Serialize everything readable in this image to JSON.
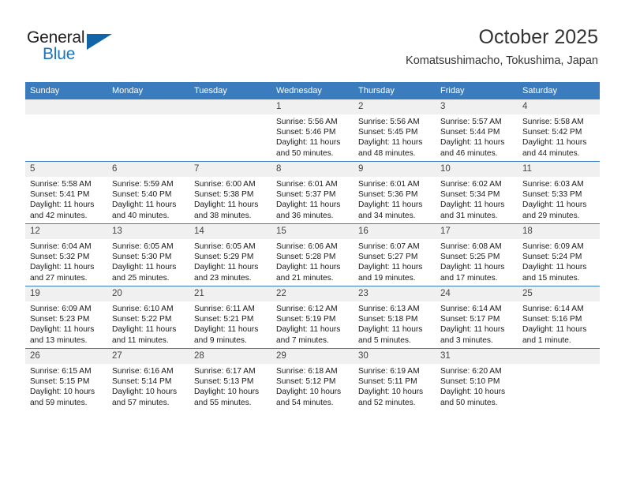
{
  "brand": {
    "name_part1": "General",
    "name_part2": "Blue"
  },
  "header": {
    "title": "October 2025",
    "subtitle": "Komatsushimacho, Tokushima, Japan"
  },
  "weekday_headers": [
    "Sunday",
    "Monday",
    "Tuesday",
    "Wednesday",
    "Thursday",
    "Friday",
    "Saturday"
  ],
  "colors": {
    "header_blue": "#3a7cbe",
    "brand_blue": "#1a74bb",
    "daynum_bg": "#f0f0f0",
    "text": "#1a1a1a"
  },
  "weeks": [
    [
      {
        "day": "",
        "empty": true,
        "sunrise": "",
        "sunset": "",
        "daylight1": "",
        "daylight2": ""
      },
      {
        "day": "",
        "empty": true,
        "sunrise": "",
        "sunset": "",
        "daylight1": "",
        "daylight2": ""
      },
      {
        "day": "",
        "empty": true,
        "sunrise": "",
        "sunset": "",
        "daylight1": "",
        "daylight2": ""
      },
      {
        "day": "1",
        "sunrise": "Sunrise: 5:56 AM",
        "sunset": "Sunset: 5:46 PM",
        "daylight1": "Daylight: 11 hours",
        "daylight2": "and 50 minutes."
      },
      {
        "day": "2",
        "sunrise": "Sunrise: 5:56 AM",
        "sunset": "Sunset: 5:45 PM",
        "daylight1": "Daylight: 11 hours",
        "daylight2": "and 48 minutes."
      },
      {
        "day": "3",
        "sunrise": "Sunrise: 5:57 AM",
        "sunset": "Sunset: 5:44 PM",
        "daylight1": "Daylight: 11 hours",
        "daylight2": "and 46 minutes."
      },
      {
        "day": "4",
        "sunrise": "Sunrise: 5:58 AM",
        "sunset": "Sunset: 5:42 PM",
        "daylight1": "Daylight: 11 hours",
        "daylight2": "and 44 minutes."
      }
    ],
    [
      {
        "day": "5",
        "sunrise": "Sunrise: 5:58 AM",
        "sunset": "Sunset: 5:41 PM",
        "daylight1": "Daylight: 11 hours",
        "daylight2": "and 42 minutes."
      },
      {
        "day": "6",
        "sunrise": "Sunrise: 5:59 AM",
        "sunset": "Sunset: 5:40 PM",
        "daylight1": "Daylight: 11 hours",
        "daylight2": "and 40 minutes."
      },
      {
        "day": "7",
        "sunrise": "Sunrise: 6:00 AM",
        "sunset": "Sunset: 5:38 PM",
        "daylight1": "Daylight: 11 hours",
        "daylight2": "and 38 minutes."
      },
      {
        "day": "8",
        "sunrise": "Sunrise: 6:01 AM",
        "sunset": "Sunset: 5:37 PM",
        "daylight1": "Daylight: 11 hours",
        "daylight2": "and 36 minutes."
      },
      {
        "day": "9",
        "sunrise": "Sunrise: 6:01 AM",
        "sunset": "Sunset: 5:36 PM",
        "daylight1": "Daylight: 11 hours",
        "daylight2": "and 34 minutes."
      },
      {
        "day": "10",
        "sunrise": "Sunrise: 6:02 AM",
        "sunset": "Sunset: 5:34 PM",
        "daylight1": "Daylight: 11 hours",
        "daylight2": "and 31 minutes."
      },
      {
        "day": "11",
        "sunrise": "Sunrise: 6:03 AM",
        "sunset": "Sunset: 5:33 PM",
        "daylight1": "Daylight: 11 hours",
        "daylight2": "and 29 minutes."
      }
    ],
    [
      {
        "day": "12",
        "sunrise": "Sunrise: 6:04 AM",
        "sunset": "Sunset: 5:32 PM",
        "daylight1": "Daylight: 11 hours",
        "daylight2": "and 27 minutes."
      },
      {
        "day": "13",
        "sunrise": "Sunrise: 6:05 AM",
        "sunset": "Sunset: 5:30 PM",
        "daylight1": "Daylight: 11 hours",
        "daylight2": "and 25 minutes."
      },
      {
        "day": "14",
        "sunrise": "Sunrise: 6:05 AM",
        "sunset": "Sunset: 5:29 PM",
        "daylight1": "Daylight: 11 hours",
        "daylight2": "and 23 minutes."
      },
      {
        "day": "15",
        "sunrise": "Sunrise: 6:06 AM",
        "sunset": "Sunset: 5:28 PM",
        "daylight1": "Daylight: 11 hours",
        "daylight2": "and 21 minutes."
      },
      {
        "day": "16",
        "sunrise": "Sunrise: 6:07 AM",
        "sunset": "Sunset: 5:27 PM",
        "daylight1": "Daylight: 11 hours",
        "daylight2": "and 19 minutes."
      },
      {
        "day": "17",
        "sunrise": "Sunrise: 6:08 AM",
        "sunset": "Sunset: 5:25 PM",
        "daylight1": "Daylight: 11 hours",
        "daylight2": "and 17 minutes."
      },
      {
        "day": "18",
        "sunrise": "Sunrise: 6:09 AM",
        "sunset": "Sunset: 5:24 PM",
        "daylight1": "Daylight: 11 hours",
        "daylight2": "and 15 minutes."
      }
    ],
    [
      {
        "day": "19",
        "sunrise": "Sunrise: 6:09 AM",
        "sunset": "Sunset: 5:23 PM",
        "daylight1": "Daylight: 11 hours",
        "daylight2": "and 13 minutes."
      },
      {
        "day": "20",
        "sunrise": "Sunrise: 6:10 AM",
        "sunset": "Sunset: 5:22 PM",
        "daylight1": "Daylight: 11 hours",
        "daylight2": "and 11 minutes."
      },
      {
        "day": "21",
        "sunrise": "Sunrise: 6:11 AM",
        "sunset": "Sunset: 5:21 PM",
        "daylight1": "Daylight: 11 hours",
        "daylight2": "and 9 minutes."
      },
      {
        "day": "22",
        "sunrise": "Sunrise: 6:12 AM",
        "sunset": "Sunset: 5:19 PM",
        "daylight1": "Daylight: 11 hours",
        "daylight2": "and 7 minutes."
      },
      {
        "day": "23",
        "sunrise": "Sunrise: 6:13 AM",
        "sunset": "Sunset: 5:18 PM",
        "daylight1": "Daylight: 11 hours",
        "daylight2": "and 5 minutes."
      },
      {
        "day": "24",
        "sunrise": "Sunrise: 6:14 AM",
        "sunset": "Sunset: 5:17 PM",
        "daylight1": "Daylight: 11 hours",
        "daylight2": "and 3 minutes."
      },
      {
        "day": "25",
        "sunrise": "Sunrise: 6:14 AM",
        "sunset": "Sunset: 5:16 PM",
        "daylight1": "Daylight: 11 hours",
        "daylight2": "and 1 minute."
      }
    ],
    [
      {
        "day": "26",
        "sunrise": "Sunrise: 6:15 AM",
        "sunset": "Sunset: 5:15 PM",
        "daylight1": "Daylight: 10 hours",
        "daylight2": "and 59 minutes."
      },
      {
        "day": "27",
        "sunrise": "Sunrise: 6:16 AM",
        "sunset": "Sunset: 5:14 PM",
        "daylight1": "Daylight: 10 hours",
        "daylight2": "and 57 minutes."
      },
      {
        "day": "28",
        "sunrise": "Sunrise: 6:17 AM",
        "sunset": "Sunset: 5:13 PM",
        "daylight1": "Daylight: 10 hours",
        "daylight2": "and 55 minutes."
      },
      {
        "day": "29",
        "sunrise": "Sunrise: 6:18 AM",
        "sunset": "Sunset: 5:12 PM",
        "daylight1": "Daylight: 10 hours",
        "daylight2": "and 54 minutes."
      },
      {
        "day": "30",
        "sunrise": "Sunrise: 6:19 AM",
        "sunset": "Sunset: 5:11 PM",
        "daylight1": "Daylight: 10 hours",
        "daylight2": "and 52 minutes."
      },
      {
        "day": "31",
        "sunrise": "Sunrise: 6:20 AM",
        "sunset": "Sunset: 5:10 PM",
        "daylight1": "Daylight: 10 hours",
        "daylight2": "and 50 minutes."
      },
      {
        "day": "",
        "empty": true,
        "sunrise": "",
        "sunset": "",
        "daylight1": "",
        "daylight2": ""
      }
    ]
  ]
}
